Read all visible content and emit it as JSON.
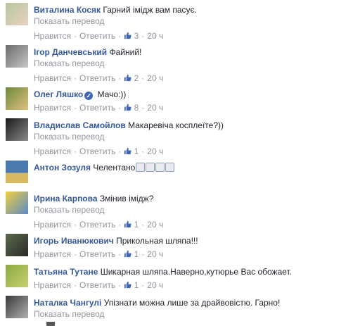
{
  "ui": {
    "translate_label": "Показать перевод",
    "like_label": "Нравится",
    "reply_label": "Ответить"
  },
  "colors": {
    "author": "#365899",
    "meta": "#90949c",
    "verified": "#4267b2"
  },
  "comments": [
    {
      "author": "Виталина Косяк",
      "text": "Гарний імідж вам пасує.",
      "likes": "3",
      "time": "20 ч",
      "avatar_colors": [
        "#b8c8a0",
        "#e8d0c0"
      ]
    },
    {
      "author": "Ігор Данчевський",
      "text": "Файний!",
      "likes": "2",
      "time": "20 ч",
      "avatar_colors": [
        "#6a6a6a",
        "#c8c8c8"
      ]
    },
    {
      "author": "Олег Ляшко",
      "text": "Мачо:))",
      "likes": "8",
      "time": "20 ч",
      "verified": true,
      "avatar_colors": [
        "#6e8a3a",
        "#e0c080"
      ]
    },
    {
      "author": "Владислав Самойлов",
      "text": "Макаревіча косплеїте?))",
      "likes": "1",
      "time": "20 ч",
      "avatar_colors": [
        "#1a1a1a",
        "#8a8a8a"
      ]
    },
    {
      "author": "Антон Зозуля",
      "text": "Челентано",
      "emoji_count": 4,
      "avatar_colors": [
        "#4a7ab0",
        "#d8b860"
      ]
    },
    {
      "author": "Ирина Карпова",
      "text": "Змінив імідж?",
      "likes": "1",
      "time": "20 ч",
      "avatar_colors": [
        "#f0d040",
        "#5a8ac8"
      ]
    },
    {
      "author": "Игорь Иванюкович",
      "text": "Прикольная шляпа!!!",
      "likes": "1",
      "time": "20 ч",
      "avatar_colors": [
        "#5a6a4a",
        "#2a2a2a"
      ]
    },
    {
      "author": "Татьяна Тутане",
      "text": "Шикарная шляпа.Наверно,кутюрье Вас обожает.",
      "likes": "1",
      "time": "20 ч",
      "avatar_colors": [
        "#8aa840",
        "#c8d070"
      ]
    },
    {
      "author": "Наталка Чангулі",
      "text": "Упізнати можна лише за драйвовістю. Гарно!",
      "avatar_colors": [
        "#3a3a3a",
        "#b0b0b0"
      ]
    }
  ]
}
